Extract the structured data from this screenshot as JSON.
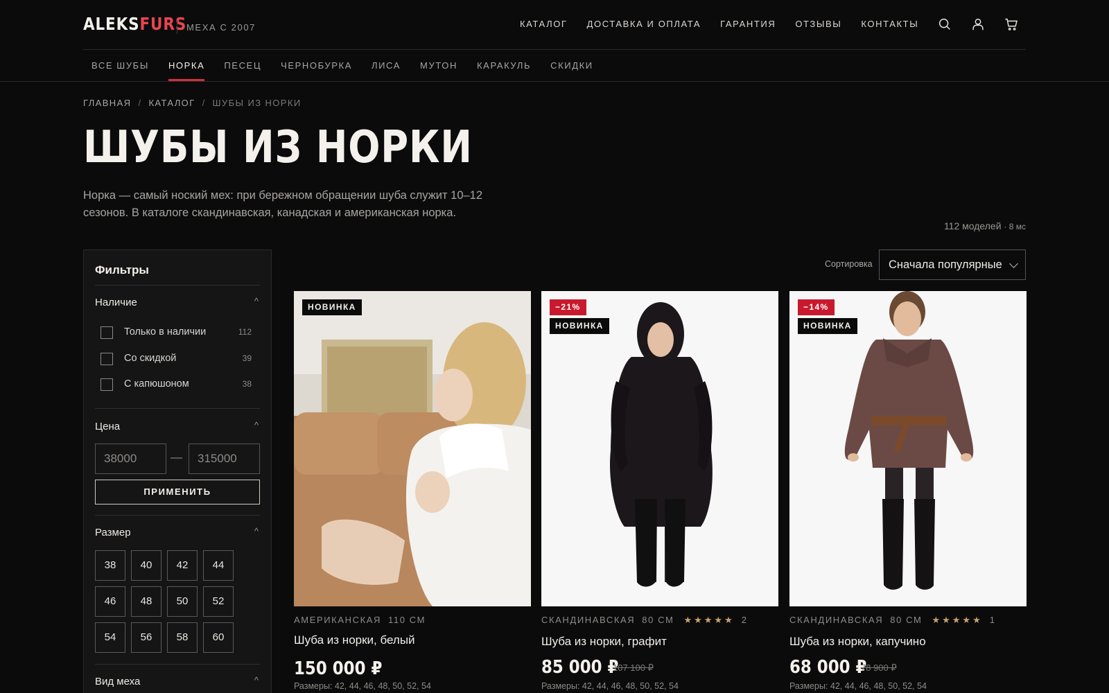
{
  "brand": {
    "name_part1": "ALEKS",
    "name_part2": "FURS",
    "tagline": "МЕХА С 2007"
  },
  "topnav": [
    "КАТАЛОГ",
    "ДОСТАВКА И ОПЛАТА",
    "ГАРАНТИЯ",
    "ОТЗЫВЫ",
    "КОНТАКТЫ"
  ],
  "header_icons": [
    "search-icon",
    "user-icon",
    "cart-icon"
  ],
  "catnav": [
    "ВСЕ ШУБЫ",
    "НОРКА",
    "ПЕСЕЦ",
    "ЧЕРНОБУРКА",
    "ЛИСА",
    "МУТОН",
    "КАРАКУЛЬ",
    "СКИДКИ"
  ],
  "catnav_active": "НОРКА",
  "breadcrumb": [
    "ГЛАВНАЯ",
    "КАТАЛОГ",
    "ШУБЫ ИЗ НОРКИ"
  ],
  "page": {
    "title": "ШУБЫ ИЗ НОРКИ",
    "intro": "Норка — самый ноский мех: при бережном обращении шуба служит 10–12 сезонов. В каталоге скандинавская, канадская и американская норка.",
    "count": "112 моделей",
    "timing": "· 8 мс"
  },
  "filters": {
    "title": "Фильтры",
    "availability": {
      "heading": "Наличие",
      "options": [
        {
          "label": "Только в наличии",
          "count": "112"
        },
        {
          "label": "Со скидкой",
          "count": "39"
        },
        {
          "label": "С капюшоном",
          "count": "38"
        }
      ]
    },
    "price": {
      "heading": "Цена",
      "min_placeholder": "38000",
      "max_placeholder": "315000",
      "dash": "—",
      "apply_label": "ПРИМЕНИТЬ"
    },
    "size": {
      "heading": "Размер",
      "options": [
        "38",
        "40",
        "42",
        "44",
        "46",
        "48",
        "50",
        "52",
        "54",
        "56",
        "58",
        "60"
      ]
    },
    "fur_type": {
      "heading": "Вид меха"
    },
    "chevron": "^"
  },
  "sort": {
    "label": "Сортировка",
    "value": "Сначала популярные"
  },
  "products": [
    {
      "badges": [
        {
          "type": "new",
          "text": "НОВИНКА"
        }
      ],
      "origin": "АМЕРИКАНСКАЯ",
      "length": "110 СМ",
      "name": "Шуба из норки, белый",
      "price": "150 000 ₽",
      "sizes": "Размеры: 42, 44, 46, 48, 50, 52, 54",
      "photo_colors": {
        "coat": "#f3f1ec",
        "background": "#d9d4cc",
        "accent": "#b88a63"
      }
    },
    {
      "badges": [
        {
          "type": "sale",
          "text": "−21%"
        },
        {
          "type": "new",
          "text": "НОВИНКА"
        }
      ],
      "origin": "СКАНДИНАВСКАЯ",
      "length": "80 СМ",
      "stars": "★★★★★",
      "rating_count": "2",
      "name": "Шуба из норки, графит",
      "price": "85 000 ₽",
      "old_price": "107 100 ₽",
      "sizes": "Размеры: 42, 44, 46, 48, 50, 52, 54",
      "photo_colors": {
        "coat": "#1c171a",
        "background": "#f7f7f7"
      }
    },
    {
      "badges": [
        {
          "type": "sale",
          "text": "−14%"
        },
        {
          "type": "new",
          "text": "НОВИНКА"
        }
      ],
      "origin": "СКАНДИНАВСКАЯ",
      "length": "80 СМ",
      "stars": "★★★★★",
      "rating_count": "1",
      "name": "Шуба из норки, капучино",
      "price": "68 000 ₽",
      "old_price": "78 900 ₽",
      "sizes": "Размеры: 42, 44, 46, 48, 50, 52, 54",
      "photo_colors": {
        "coat": "#6b4a46",
        "background": "#f7f7f7",
        "belt": "#7a4a2a"
      }
    }
  ],
  "colors": {
    "accent": "#d1303b",
    "sale": "#c8192e",
    "star": "#c9a36b",
    "background": "#0b0b0c",
    "panel": "#151516"
  }
}
